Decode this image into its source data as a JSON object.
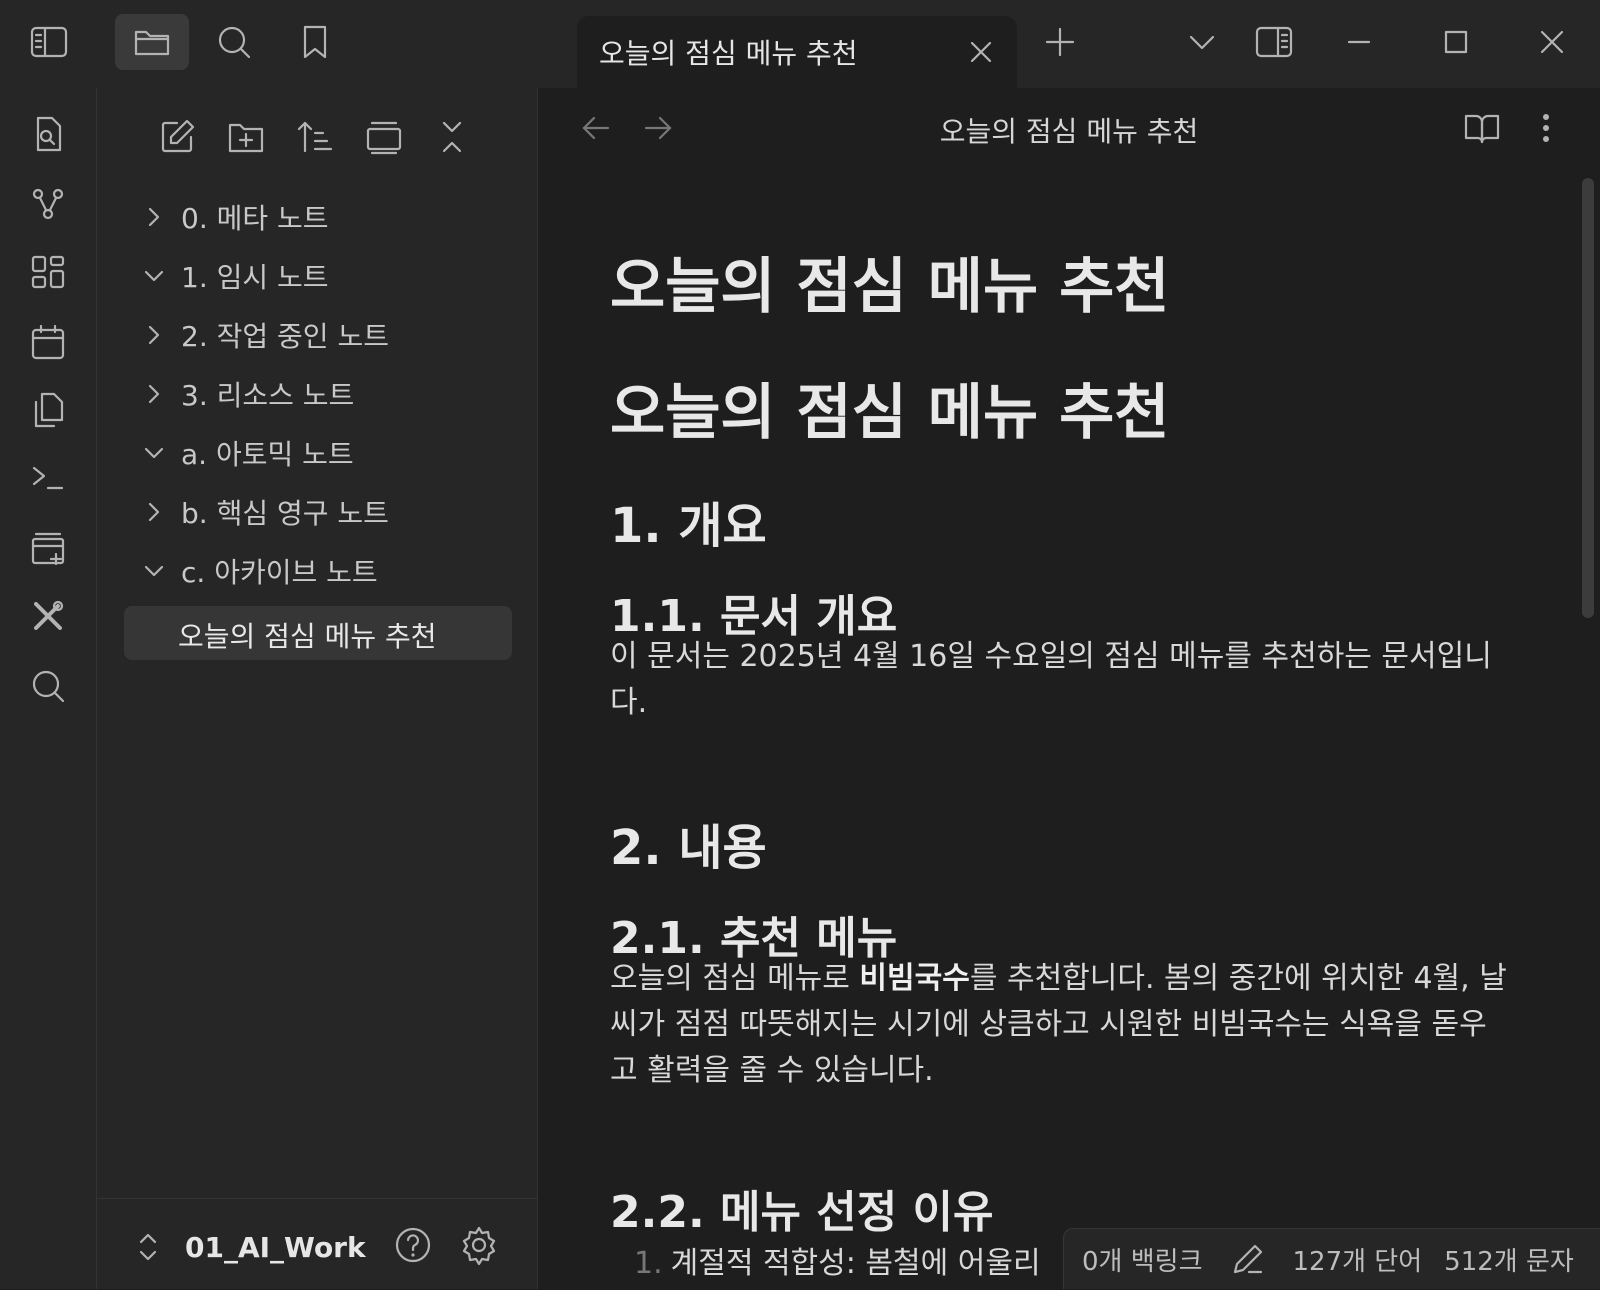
{
  "tab": {
    "title": "오늘의 점심 메뉴 추천"
  },
  "view_header": {
    "title": "오늘의 점심 메뉴 추천"
  },
  "explorer": {
    "folders": [
      {
        "label": "0. 메타 노트",
        "expanded": false
      },
      {
        "label": "1. 임시 노트",
        "expanded": true
      },
      {
        "label": "2. 작업 중인 노트",
        "expanded": false
      },
      {
        "label": "3. 리소스 노트",
        "expanded": false
      },
      {
        "label": "a. 아토믹 노트",
        "expanded": true
      },
      {
        "label": "b. 핵심 영구 노트",
        "expanded": false
      },
      {
        "label": "c. 아카이브 노트",
        "expanded": true
      }
    ],
    "active_file": "오늘의 점심 메뉴 추천"
  },
  "vault": {
    "name": "01_AI_Work"
  },
  "document": {
    "h1a": "오늘의 점심 메뉴 추천",
    "h1b": "오늘의 점심 메뉴 추천",
    "s1": "1. 개요",
    "s1_1": "1.1. 문서 개요",
    "s1_1_text": "이 문서는 2025년 4월 16일 수요일의 점심 메뉴를 추천하는 문서입니다.",
    "s2": "2. 내용",
    "s2_1": "2.1. 추천 메뉴",
    "s2_1_pre": "오늘의 점심 메뉴로 ",
    "s2_1_bold": "비빔국수",
    "s2_1_post": "를 추천합니다. 봄의 중간에 위치한 4월, 날씨가 점점 따뜻해지는 시기에 상큼하고 시원한 비빔국수는 식욕을 돋우고 활력을 줄 수 있습니다.",
    "s2_2": "2.2. 메뉴 선정 이유",
    "list_num": "1.",
    "list_text": "계절적 적합성: 봄철에 어울리"
  },
  "status": {
    "backlinks": "0개 백링크",
    "words": "127개 단어",
    "chars": "512개 문자"
  }
}
